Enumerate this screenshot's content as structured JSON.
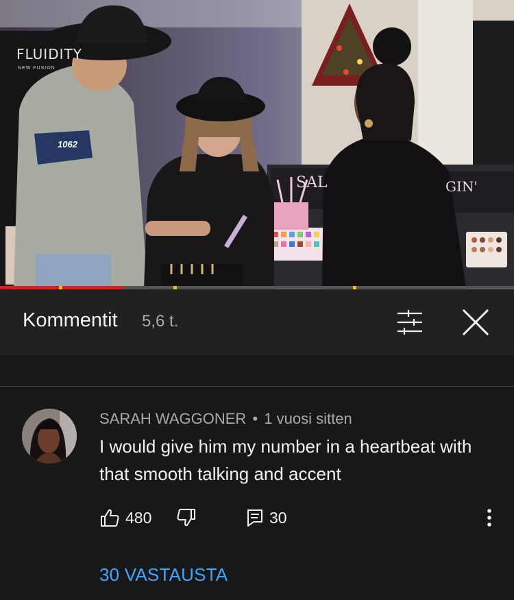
{
  "video": {
    "store_sign": "FLUIDITY",
    "sign_small": "NEW FUSION",
    "palette_sign_left": "SAL",
    "palette_sign_right": "GIN'",
    "jacket_patch": "1062",
    "progress_played_fraction": 0.24
  },
  "comments_header": {
    "title": "Kommentit",
    "count": "5,6 t.",
    "sort_icon": "sort-sliders-icon",
    "close_icon": "close-icon"
  },
  "comment": {
    "author": "SARAH WAGGONER",
    "separator": "•",
    "time": "1 vuosi sitten",
    "text": "I would give him my number in a heartbeat with that smooth talking and accent",
    "likes": "480",
    "reply_count": "30",
    "like_icon": "thumb-up-icon",
    "dislike_icon": "thumb-down-icon",
    "reply_icon": "reply-icon",
    "more_icon": "more-vert-icon",
    "replies_label": "30 VASTAUSTA"
  },
  "colors": {
    "background": "#181818",
    "header_background": "#212121",
    "link_blue": "#3ea6ff",
    "progress_red": "#e21b1b",
    "ad_marker": "#f5c400"
  }
}
